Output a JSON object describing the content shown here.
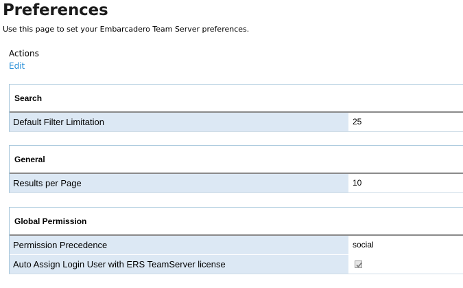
{
  "page": {
    "title": "Preferences",
    "subtitle": "Use this page to set your Embarcadero Team Server preferences."
  },
  "actions": {
    "label": "Actions",
    "edit_link": "Edit"
  },
  "sections": [
    {
      "title": "Search",
      "rows": [
        {
          "label": "Default Filter Limitation",
          "value": "25"
        }
      ]
    },
    {
      "title": "General",
      "rows": [
        {
          "label": "Results per Page",
          "value": "10"
        }
      ]
    },
    {
      "title": "Global Permission",
      "rows": [
        {
          "label": "Permission Precedence",
          "value": "social"
        },
        {
          "label": "Auto Assign Login User with ERS TeamServer license",
          "checked": true,
          "disabled": true
        }
      ]
    }
  ],
  "colors": {
    "link": "#1f8ad6",
    "label_background": "#dce8f4",
    "section_border": "#a9c8dc"
  }
}
